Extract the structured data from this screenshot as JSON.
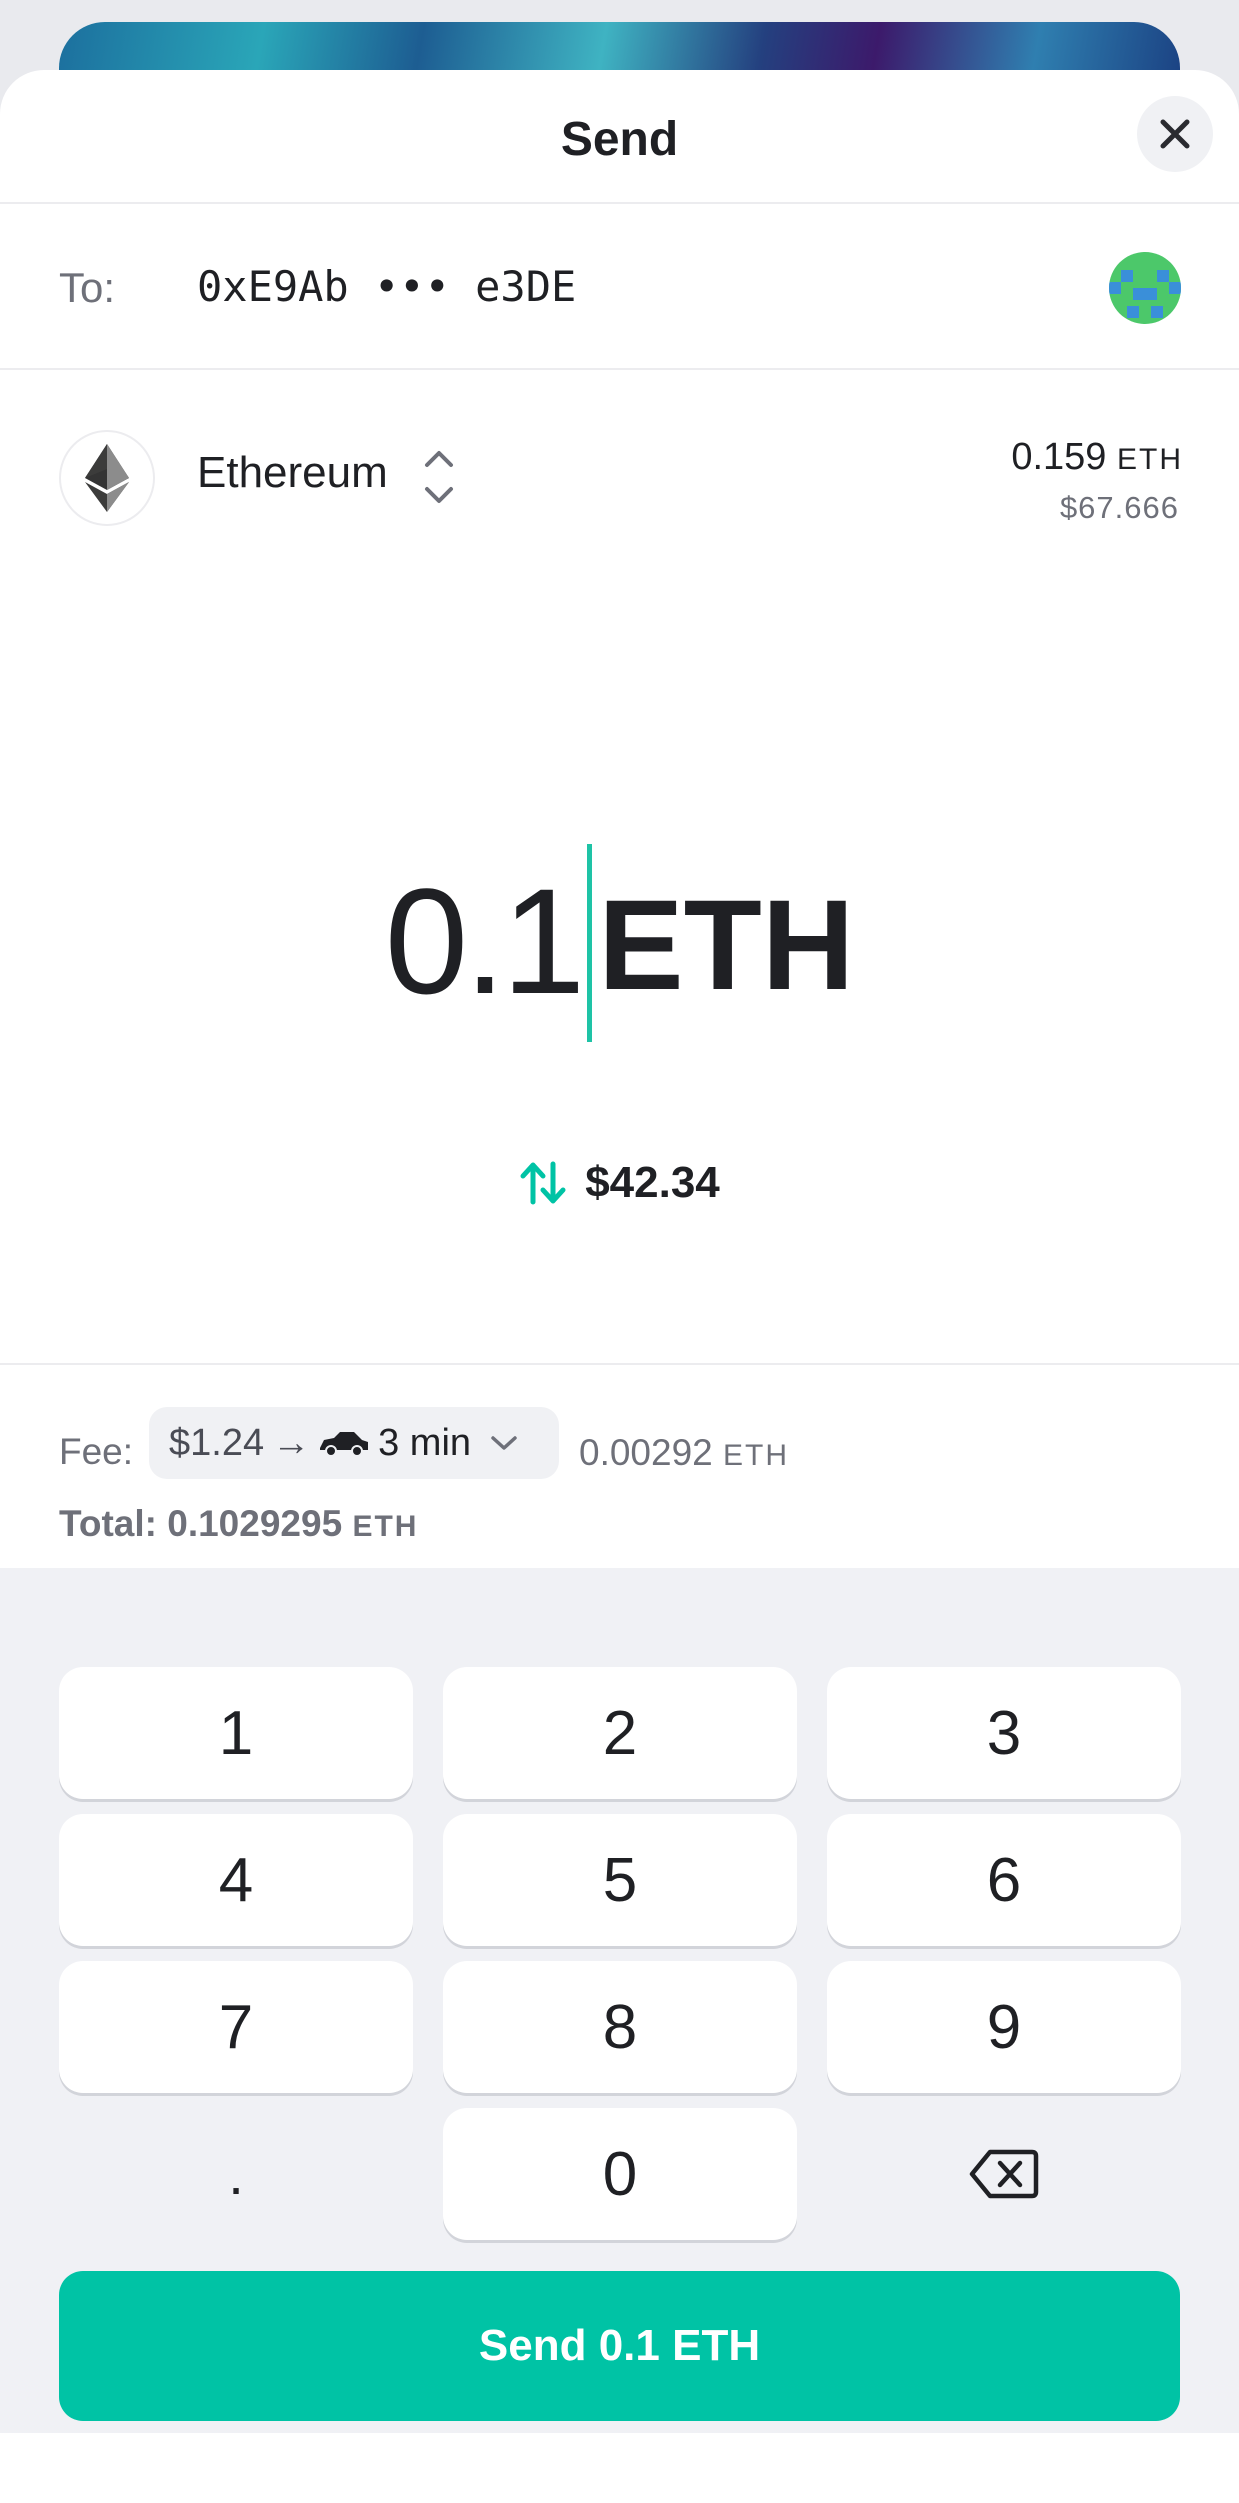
{
  "sheet": {
    "title": "Send",
    "close_icon": "close-icon"
  },
  "recipient": {
    "label": "To:",
    "address": "0xE9Ab ••• e3DE",
    "avatar_icon": "pixel-avatar-icon",
    "avatar_colors": [
      "#4cc86a",
      "#3a8fd9"
    ]
  },
  "token": {
    "name": "Ethereum",
    "icon": "ethereum-icon",
    "switch_icon": "chevron-up-down-icon",
    "balance_amount": "0.159",
    "balance_unit": "ETH",
    "balance_usd": "$67.666"
  },
  "amount": {
    "value": "0.1",
    "unit": "ETH",
    "fiat": "$42.34",
    "swap_icon": "swap-arrows-icon"
  },
  "fee": {
    "label": "Fee:",
    "usd": "$1.24",
    "arrow": "→",
    "speed_icon": "car-icon",
    "time": "3 min",
    "dropdown_icon": "chevron-down-icon",
    "eth_amount": "0.00292",
    "eth_unit": "ETH",
    "total_label": "Total:",
    "total_amount": "0.1029295",
    "total_unit": "ETH"
  },
  "keypad": {
    "keys": [
      "1",
      "2",
      "3",
      "4",
      "5",
      "6",
      "7",
      "8",
      "9",
      ".",
      "0"
    ],
    "backspace_icon": "backspace-icon"
  },
  "send_button": {
    "label": "Send 0.1 ETH"
  },
  "colors": {
    "accent": "#00c3a5",
    "caret": "#1ec3a6",
    "text": "#1f2024",
    "muted": "#6e7079"
  }
}
